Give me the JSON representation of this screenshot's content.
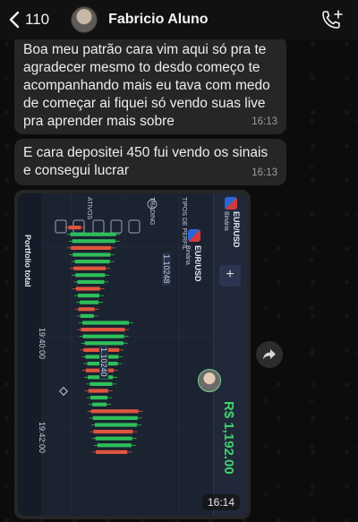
{
  "header": {
    "back_count": "110",
    "contact_name": "Fabricio Aluno"
  },
  "messages": [
    {
      "text": "Boa meu patrão cara vim aqui só pra te agradecer mesmo to desdo começo te acompanhando mais eu tava com medo de começar ai fiquei só vendo suas live pra aprender mais sobre",
      "time": "16:13"
    },
    {
      "text": "E cara depositei 450 fui vendo os sinais e consegui lucrar",
      "time": "16:13"
    }
  ],
  "image_message": {
    "time": "16:14",
    "screenshot": {
      "pair": "EUR/USD",
      "market": "Binária",
      "balance": "R$ 1,192.00",
      "chart_title": "Portfolio total",
      "price_label_1": "1.10248",
      "price_label_2": "1.10240",
      "time_label_1": "19:40:00",
      "time_label_2": "19:42:00",
      "menu_1": "TIPOS DE PERFIL",
      "menu_2": "TRADING",
      "menu_3": "ATIVOS"
    }
  },
  "icons": {
    "back": "chevron-left-icon",
    "call": "phone-plus-icon",
    "forward": "forward-arrow-icon"
  },
  "colors": {
    "bubble": "#262626",
    "background": "#0c0c0c",
    "up_candle": "#2fbf5a",
    "down_candle": "#e0563f",
    "balance_green": "#3fd26d"
  }
}
